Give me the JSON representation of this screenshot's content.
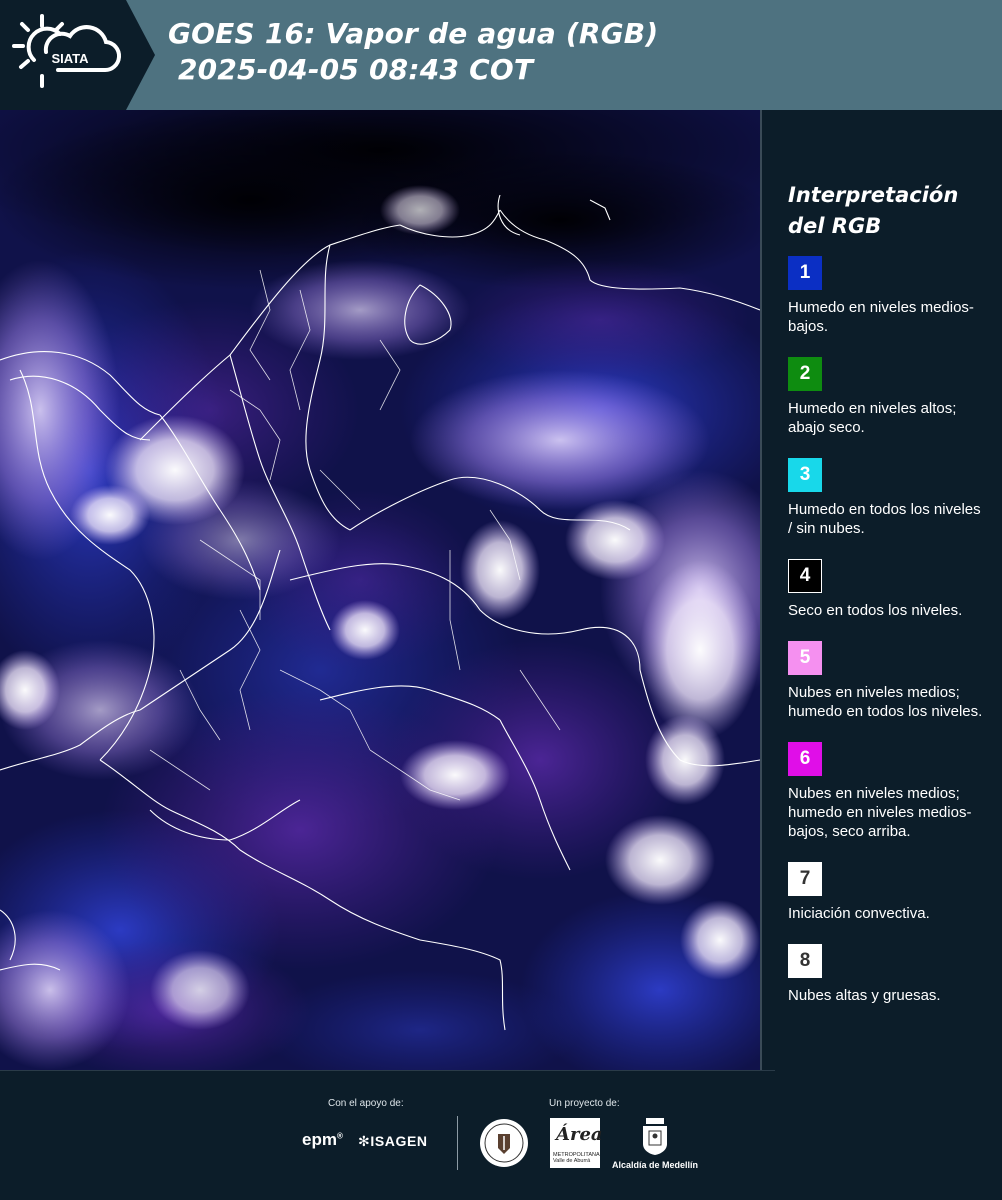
{
  "header": {
    "logo_text": "SIATA",
    "title_line1": "GOES 16: Vapor de agua (RGB)",
    "title_line2": " 2025-04-05 08:43 COT"
  },
  "colors": {
    "header_bg": "#4e7280",
    "page_bg": "#0c1d29",
    "map_bg": "#0d0e38"
  },
  "legend": {
    "title_line1": "Interpretación",
    "title_line2": "del RGB",
    "items": [
      {
        "num": "1",
        "color": "#0b2fc4",
        "text_color": "#ffffff",
        "label": "Humedo en niveles medios-bajos."
      },
      {
        "num": "2",
        "color": "#0e8c10",
        "text_color": "#ffffff",
        "label": "Humedo en niveles altos; abajo seco."
      },
      {
        "num": "3",
        "color": "#18d8ea",
        "text_color": "#ffffff",
        "label": "Humedo en todos los niveles / sin nubes."
      },
      {
        "num": "4",
        "color": "#000000",
        "text_color": "#ffffff",
        "label": "Seco en todos los niveles."
      },
      {
        "num": "5",
        "color": "#f590f0",
        "text_color": "#ffffff",
        "label": "Nubes en niveles medios; humedo en todos los niveles."
      },
      {
        "num": "6",
        "color": "#e00ee8",
        "text_color": "#ffffff",
        "label": "Nubes en niveles medios; humedo en niveles medios-bajos, seco arriba."
      },
      {
        "num": "7",
        "color": "#ffffff",
        "text_color": "#333333",
        "label": "Iniciación convectiva."
      },
      {
        "num": "8",
        "color": "#ffffff",
        "text_color": "#333333",
        "label": "Nubes altas y gruesas."
      }
    ]
  },
  "footer": {
    "support_label": "Con el apoyo de:",
    "project_label": "Un proyecto de:",
    "epm": "epm",
    "isagen": "ISAGEN",
    "area_logo": "Área",
    "area_sub1": "METROPOLITANA",
    "area_sub2": "Valle de Aburrá",
    "alcaldia": "Alcaldía de Medellín"
  }
}
